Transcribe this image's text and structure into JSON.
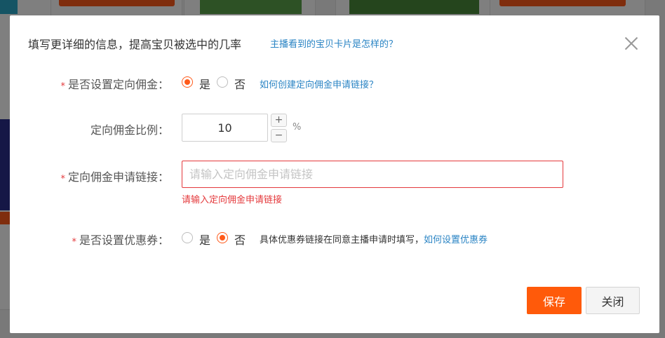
{
  "dialog": {
    "title": "填写更详细的信息，提高宝贝被选中的几率",
    "help_link": "主播看到的宝贝卡片是怎样的？"
  },
  "form": {
    "required_mark": "*",
    "directed_commission": {
      "label": "是否设置定向佣金：",
      "option_yes": "是",
      "option_no": "否",
      "selected": "是",
      "help_link": "如何创建定向佣金申请链接？"
    },
    "commission_rate": {
      "label": "定向佣金比例：",
      "value": "10",
      "increment": "+",
      "decrement": "−",
      "unit": "%"
    },
    "application_link": {
      "label": "定向佣金申请链接：",
      "value": "",
      "placeholder": "请输入定向佣金申请链接",
      "error": "请输入定向佣金申请链接"
    },
    "coupon": {
      "label": "是否设置优惠券：",
      "option_yes": "是",
      "option_no": "否",
      "selected": "否",
      "note": "具体优惠券链接在同意主播申请时填写，",
      "help_link": "如何设置优惠券"
    }
  },
  "buttons": {
    "save": "保存",
    "close": "关闭"
  },
  "colors": {
    "accent": "#ff5a0a",
    "link": "#2a84c4",
    "error": "#e4393c"
  }
}
